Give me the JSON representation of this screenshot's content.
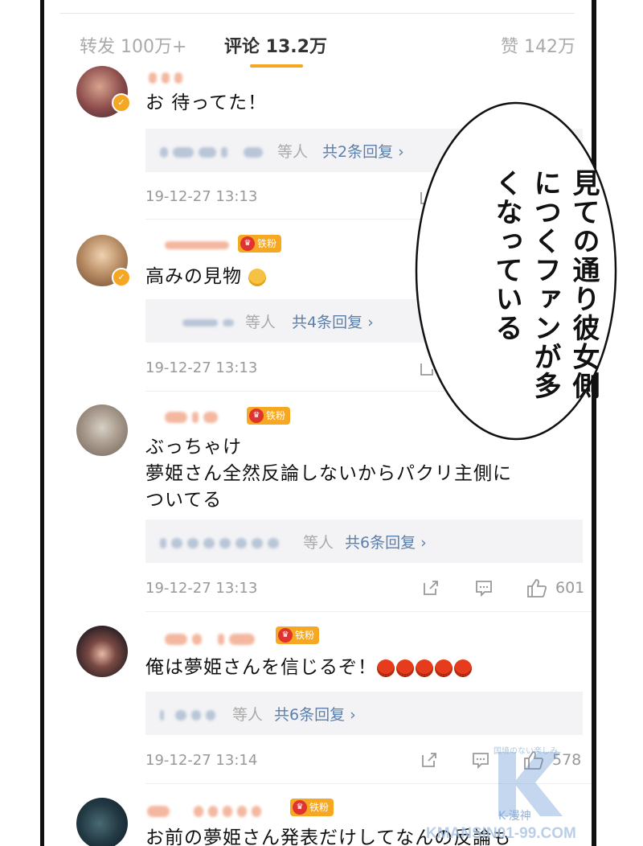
{
  "tabs": {
    "repost": "转发 100万+",
    "comments": "评论 13.2万",
    "likes": "赞 142万"
  },
  "comments": [
    {
      "text": "お 待ってた！",
      "reply_suffix": "等人",
      "reply_link": "共2条回复 ›",
      "timestamp": "19-12-27 13:13"
    },
    {
      "text": "高みの見物",
      "badge": "铁粉",
      "reply_suffix": "等人",
      "reply_link": "共4条回复 ›",
      "timestamp": "19-12-27 13:13"
    },
    {
      "text_line1": "ぶっちゃけ",
      "text_line2": "夢姫さん全然反論しないからパクリ主側に",
      "text_line3": "ついてる",
      "badge": "铁粉",
      "reply_suffix": "等人",
      "reply_link": "共6条回复 ›",
      "timestamp": "19-12-27 13:13",
      "likes": "601"
    },
    {
      "text": "俺は夢姫さんを信じるぞ！",
      "badge": "铁粉",
      "reply_suffix": "等人",
      "reply_link": "共6条回复 ›",
      "timestamp": "19-12-27 13:14",
      "likes": "578"
    },
    {
      "text": "お前の夢姫さん発表だけしてなんの反論も",
      "badge": "铁粉"
    }
  ],
  "speech_bubble": "見ての通り彼女側につくファンが多くなっている",
  "watermark": {
    "small": "国境のない楽しみ",
    "brand": "K-漫神",
    "url": "KMANSIN01-99.COM"
  },
  "colors": {
    "accent": "#f5a623",
    "link": "#5b7fad",
    "badge": "#f7a823",
    "muted": "#999999"
  }
}
